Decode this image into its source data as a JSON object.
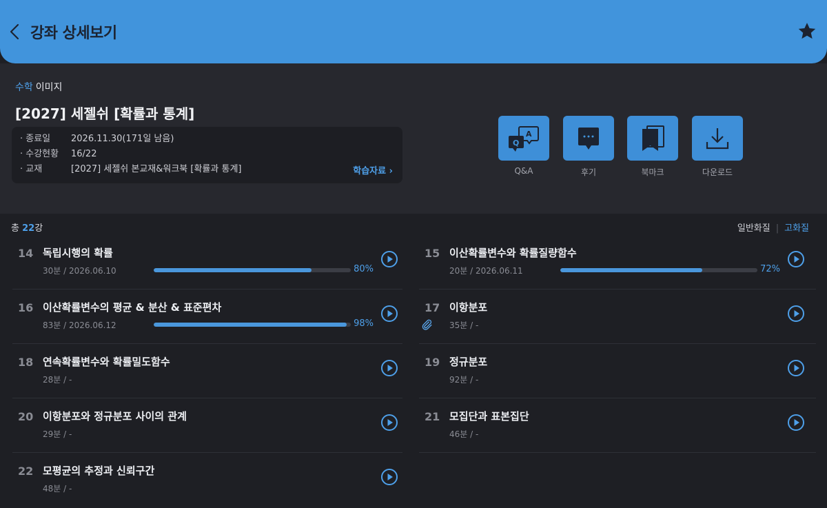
{
  "header": {
    "title": "강좌 상세보기"
  },
  "course": {
    "subject": "수학",
    "type": "이미지",
    "title": "[2027] 세젤쉬 [확률과 통계]",
    "meta": [
      {
        "label": "· 종료일",
        "value": "2026.11.30(171일 남음)"
      },
      {
        "label": "· 수강현황",
        "value": "16/22"
      },
      {
        "label": "· 교재",
        "value": "[2027] 세젤쉬 본교재&워크북 [확률과 통계]"
      }
    ],
    "study_link": "학습자료 ›"
  },
  "actions": [
    {
      "label": "Q&A",
      "icon": "qa-icon"
    },
    {
      "label": "후기",
      "icon": "chat-bubble-icon"
    },
    {
      "label": "북마크",
      "icon": "bookmark-icon"
    },
    {
      "label": "다운로드",
      "icon": "download-icon"
    }
  ],
  "list": {
    "total_prefix": "총 ",
    "total_count": "22",
    "total_suffix": "강",
    "quality_normal": "일반화질",
    "quality_high": "고화질"
  },
  "lessons": [
    {
      "num": "14",
      "title": "독립시행의 확률",
      "meta": "30분 / 2026.06.10",
      "progress": 80,
      "progress_label": "80%"
    },
    {
      "num": "15",
      "title": "이산확률변수와 확률질량함수",
      "meta": "20분 / 2026.06.11",
      "progress": 72,
      "progress_label": "72%"
    },
    {
      "num": "16",
      "title": "이산확률변수의 평균 & 분산 & 표준편차",
      "meta": "83분 / 2026.06.12",
      "progress": 98,
      "progress_label": "98%"
    },
    {
      "num": "17",
      "title": "이항분포",
      "meta": "35분 / -",
      "attachment": true
    },
    {
      "num": "18",
      "title": "연속확률변수와 확률밀도함수",
      "meta": "28분 / -"
    },
    {
      "num": "19",
      "title": "정규분포",
      "meta": "92분 / -"
    },
    {
      "num": "20",
      "title": "이항분포와 정규분포 사이의 관계",
      "meta": "29분 / -"
    },
    {
      "num": "21",
      "title": "모집단과 표본집단",
      "meta": "46분 / -"
    },
    {
      "num": "22",
      "title": "모평균의 추정과 신뢰구간",
      "meta": "48분 / -"
    }
  ],
  "colors": {
    "accent": "#4194dc",
    "background": "#1e1f24",
    "panel": "#27282e"
  }
}
